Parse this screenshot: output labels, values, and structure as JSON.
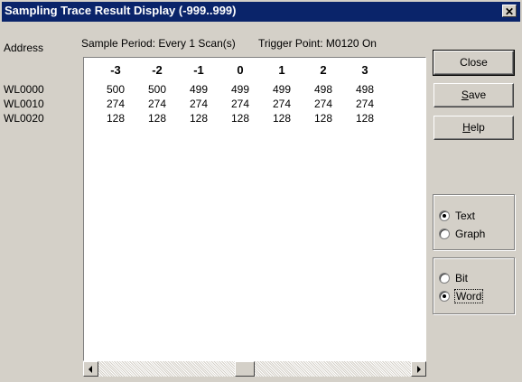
{
  "window": {
    "title": "Sampling Trace Result Display (-999..999)",
    "close_glyph": "✕"
  },
  "labels": {
    "address": "Address",
    "sample_period": "Sample Period: Every 1 Scan(s)",
    "trigger_point": "Trigger Point: M0120 On"
  },
  "addresses": [
    "WL0000",
    "WL0010",
    "WL0020"
  ],
  "table": {
    "columns": [
      "-3",
      "-2",
      "-1",
      "0",
      "1",
      "2",
      "3"
    ],
    "rows": [
      [
        "500",
        "500",
        "499",
        "499",
        "499",
        "498",
        "498"
      ],
      [
        "274",
        "274",
        "274",
        "274",
        "274",
        "274",
        "274"
      ],
      [
        "128",
        "128",
        "128",
        "128",
        "128",
        "128",
        "128"
      ]
    ]
  },
  "buttons": {
    "close": "Close",
    "save_prefix": "",
    "save_accel": "S",
    "save_rest": "ave",
    "help_prefix": "",
    "help_accel": "H",
    "help_rest": "elp"
  },
  "display_mode": {
    "options": [
      "Text",
      "Graph"
    ],
    "selected": "Text"
  },
  "data_unit": {
    "options": [
      "Bit",
      "Word"
    ],
    "selected": "Word"
  }
}
